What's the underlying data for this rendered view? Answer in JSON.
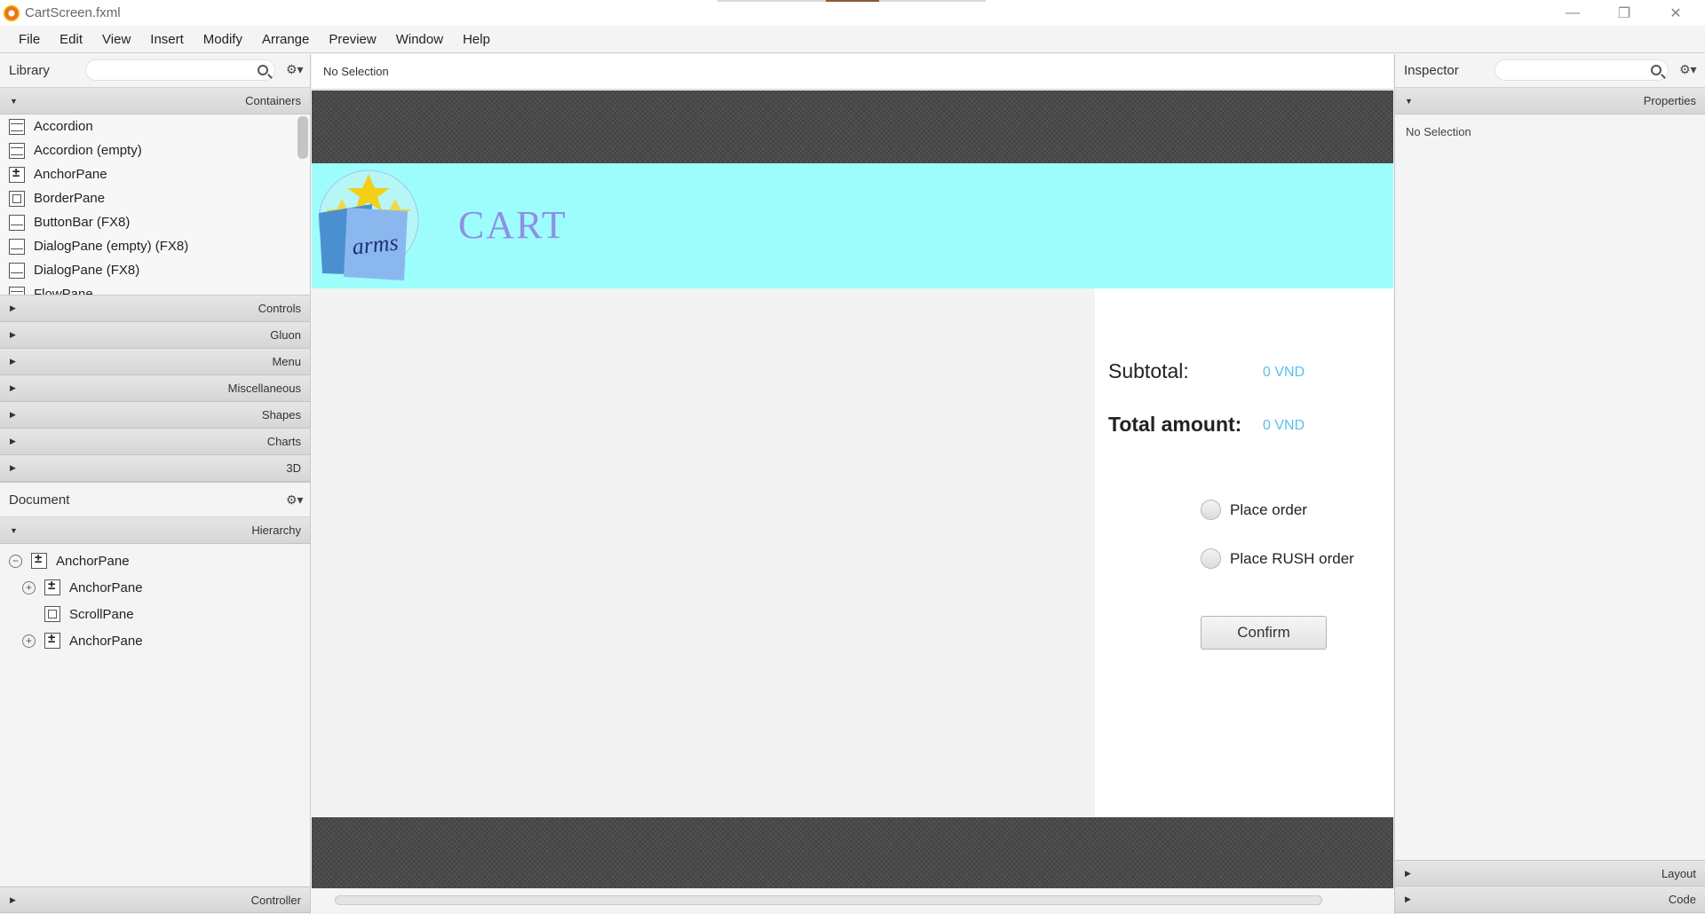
{
  "window": {
    "title": "CartScreen.fxml",
    "controls": {
      "minimize": "—",
      "maximize": "❐",
      "close": "✕"
    }
  },
  "menu": [
    "File",
    "Edit",
    "View",
    "Insert",
    "Modify",
    "Arrange",
    "Preview",
    "Window",
    "Help"
  ],
  "library": {
    "title": "Library",
    "search_placeholder": "",
    "containers_label": "Containers",
    "items": [
      "Accordion",
      "Accordion  (empty)",
      "AnchorPane",
      "BorderPane",
      "ButtonBar  (FX8)",
      "DialogPane (empty)  (FX8)",
      "DialogPane  (FX8)",
      "FlowPane"
    ],
    "sections": [
      "Controls",
      "Gluon",
      "Menu",
      "Miscellaneous",
      "Shapes",
      "Charts",
      "3D"
    ]
  },
  "document": {
    "title": "Document",
    "hierarchy_label": "Hierarchy",
    "tree": [
      "AnchorPane",
      "AnchorPane",
      "ScrollPane",
      "AnchorPane"
    ],
    "controller_label": "Controller"
  },
  "center": {
    "selection_text": "No Selection"
  },
  "cart": {
    "logo_text": "arms",
    "title": "CART",
    "subtotal_label": "Subtotal:",
    "subtotal_value": "0 VND",
    "total_label": "Total amount:",
    "total_value": "0 VND",
    "place_order": "Place order",
    "place_rush_order": "Place RUSH order",
    "confirm": "Confirm"
  },
  "inspector": {
    "title": "Inspector",
    "properties_label": "Properties",
    "no_selection": "No Selection",
    "layout_label": "Layout",
    "code_label": "Code"
  },
  "colors": {
    "header_band": "#9dfdfd",
    "cart_title": "#8e8fe6",
    "price_value": "#5ac0e8"
  }
}
